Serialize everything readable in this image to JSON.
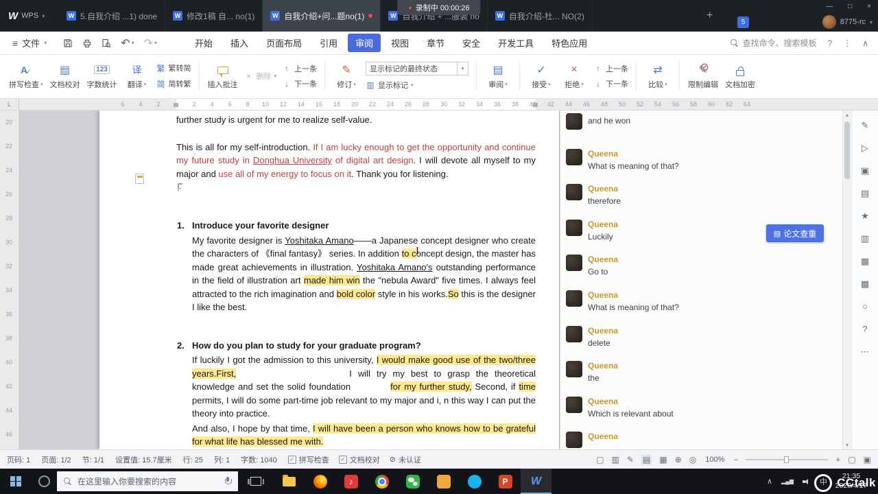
{
  "recording": {
    "label": "录制中 00:00:26"
  },
  "titlebar": {
    "brand_w": "W",
    "brand": "WPS",
    "tabs": [
      {
        "label": "5.自我介绍 ...1) done",
        "active": false
      },
      {
        "label": "修改1稿 自... no(1)",
        "active": false
      },
      {
        "label": "自我介绍+问...题no(1)",
        "active": true
      },
      {
        "label": "自我介绍 + ...服装 no",
        "active": false
      },
      {
        "label": "自我介绍-杜... NO(2)",
        "active": false
      }
    ],
    "badge_count": "5",
    "username": "8775-rc"
  },
  "menubar": {
    "file_label": "文件",
    "items": [
      {
        "label": "开始",
        "active": false
      },
      {
        "label": "插入",
        "active": false
      },
      {
        "label": "页面布局",
        "active": false
      },
      {
        "label": "引用",
        "active": false
      },
      {
        "label": "审阅",
        "active": true
      },
      {
        "label": "视图",
        "active": false
      },
      {
        "label": "章节",
        "active": false
      },
      {
        "label": "安全",
        "active": false
      },
      {
        "label": "开发工具",
        "active": false
      },
      {
        "label": "特色应用",
        "active": false
      }
    ],
    "search_label": "查找命令、搜索模板"
  },
  "ribbon": {
    "spell_check": "拼写检查",
    "proofread": "文档校对",
    "word_count": "字数统计",
    "translate": "翻译",
    "trad_to_simp": "繁转简",
    "simp_to_trad": "简转繁",
    "insert_comment": "插入批注",
    "delete": "删除",
    "prev_item": "上一条",
    "next_item": "下一条",
    "track_changes": "修订",
    "markup_state": "显示标记的最终状态",
    "show_markup": "显示标记",
    "review": "审阅",
    "accept": "接受",
    "reject": "拒绝",
    "prev_change": "上一条",
    "next_change": "下一条",
    "compare": "比较",
    "restrict_edit": "限制编辑",
    "encrypt": "文档加密"
  },
  "ruler": {
    "h_numbers": [
      "6",
      "4",
      "2",
      "2",
      "4",
      "6",
      "8",
      "10",
      "12",
      "14",
      "16",
      "18",
      "20",
      "22",
      "24",
      "26",
      "28",
      "30",
      "32",
      "34",
      "36",
      "38",
      "40",
      "42",
      "44",
      "46",
      "48",
      "50",
      "52",
      "54",
      "56",
      "58",
      "60",
      "62",
      "64"
    ],
    "v_numbers": [
      "20",
      "22",
      "24",
      "26",
      "28",
      "30",
      "32",
      "34",
      "36",
      "38",
      "40",
      "42",
      "44",
      "46"
    ]
  },
  "document": {
    "p_top": [
      {
        "t": "further study is urgent for me to realize self-value.",
        "s": ""
      }
    ],
    "p_closing": [
      {
        "t": "This is all for my self-introduction. ",
        "s": ""
      },
      {
        "t": "If I am lucky enough to get the opportunity and continue my future study in ",
        "s": "red"
      },
      {
        "t": "Donghua University",
        "s": "red u"
      },
      {
        "t": " of digital art design",
        "s": "red"
      },
      {
        "t": ". I will devote all myself to my major and ",
        "s": ""
      },
      {
        "t": "use all of my energy to focus on it",
        "s": "red"
      },
      {
        "t": ". Thank you for listening.",
        "s": ""
      }
    ],
    "q1_num": "1.",
    "q1_title": "Introduce your favorite designer",
    "q1_body": [
      {
        "t": "My favorite designer is ",
        "s": ""
      },
      {
        "t": "Yoshitaka Amano",
        "s": "u"
      },
      {
        "t": "——a Japanese concept designer who create the characters of 《final fantasy》 series. In addition ",
        "s": ""
      },
      {
        "t": "to c",
        "s": "hl"
      },
      {
        "t": "oncept design, the master has made great achievements in illustration. ",
        "s": ""
      },
      {
        "t": "Yoshitaka Amano's",
        "s": "u"
      },
      {
        "t": " outstanding performance in the field of illustration art ",
        "s": ""
      },
      {
        "t": "made him win",
        "s": "hl"
      },
      {
        "t": " the \"nebula Award\" five times. I always feel attracted to the rich imagination and ",
        "s": ""
      },
      {
        "t": "bold color",
        "s": "hl"
      },
      {
        "t": " style in his works.",
        "s": ""
      },
      {
        "t": "So",
        "s": "hl"
      },
      {
        "t": " this is the designer I like the best.",
        "s": ""
      }
    ],
    "q2_num": "2.",
    "q2_title": "How do you plan to study for your graduate program?",
    "q2_body": [
      {
        "t": "If luckily I got the admission to this university, ",
        "s": ""
      },
      {
        "t": "I would make good use of the two/three years.First,",
        "s": "hl"
      },
      {
        "t": "",
        "s": "gap-lg"
      },
      {
        "t": "I will try my best to grasp the theoretical knowledge and set the solid foundation",
        "s": ""
      },
      {
        "t": "",
        "s": "gap-sm"
      },
      {
        "t": "for my further study,",
        "s": "hl"
      },
      {
        "t": " Second, if ",
        "s": ""
      },
      {
        "t": "time",
        "s": "hl"
      },
      {
        "t": " permits, I will do some part-time job relevant to my major and i, n this way I can put the theory into practice.",
        "s": ""
      }
    ],
    "q2_body2": [
      {
        "t": "And also, I hope by that time, ",
        "s": ""
      },
      {
        "t": "I will have been a person who knows how to be grateful for what life has blessed me with.",
        "s": "hl"
      }
    ]
  },
  "comments": {
    "items": [
      {
        "author": "",
        "text": "and he won"
      },
      {
        "author": "Queena",
        "text": "What is meaning of that?"
      },
      {
        "author": "Queena",
        "text": "therefore"
      },
      {
        "author": "Queena",
        "text": "Luckily"
      },
      {
        "author": "Queena",
        "text": "Go to"
      },
      {
        "author": "Queena",
        "text": "What is meaning of that?"
      },
      {
        "author": "Queena",
        "text": "delete"
      },
      {
        "author": "Queena",
        "text": "the"
      },
      {
        "author": "Queena",
        "text": "Which is relevant about"
      },
      {
        "author": "Queena",
        "text": ""
      }
    ]
  },
  "paper_check_label": "论文查重",
  "statusbar": {
    "page_code": "页码: 1",
    "page": "页面: 1/2",
    "section": "节: 1/1",
    "setting": "设置值: 15.7厘米",
    "line": "行: 25",
    "column": "列: 1",
    "word_count": "字数: 1040",
    "spell_check": "拼写检查",
    "proofread": "文档校对",
    "not_certified": "未认证",
    "zoom_level": "100%"
  },
  "taskbar": {
    "search_placeholder": "在这里输入你要搜索的内容",
    "ime": "中",
    "time": "21:35",
    "date": "2020/4/17",
    "watermark": "CCtalk"
  },
  "icons": {
    "wps_w": "W",
    "record_dot": "●",
    "menu": "≡",
    "caret": "▾",
    "chevron_up": "∧",
    "minimize": "—",
    "maximize": "□",
    "close": "×",
    "new_tab": "+",
    "help": "?",
    "more_v": "⋮",
    "more_h": "⋯",
    "letter_a": "A",
    "check": "✓",
    "cross": "×",
    "digits": "123",
    "translate": "译",
    "trad": "繁",
    "simp": "简",
    "up_arrow": "↑",
    "down_arrow": "↓",
    "pencil": "✎",
    "swap": "⇄",
    "slash": "⊘",
    "pages": "▤",
    "doc": "▥",
    "grid": "▦",
    "shade": "▩",
    "block": "▣",
    "play": "▷",
    "star": "★",
    "ring": "○",
    "globe": "⊕",
    "eye": "◎",
    "square": "▢",
    "minus": "−",
    "plus": "+",
    "signal": "▂▄▆",
    "scroll_up": "▴",
    "scroll_down": "▾",
    "tab_L": "L",
    "music": "♪",
    "letter_p": "P"
  }
}
